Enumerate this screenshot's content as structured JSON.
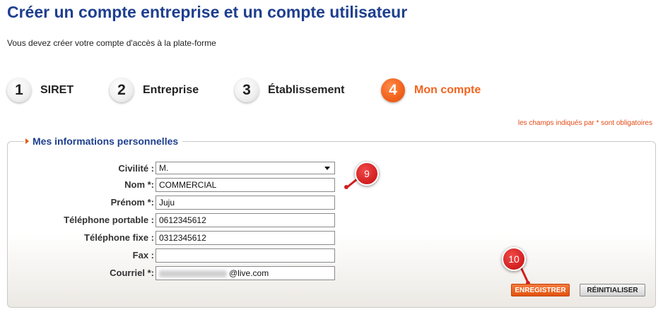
{
  "header": {
    "title": "Créer un compte entreprise et un compte utilisateur",
    "intro": "Vous devez créer votre compte d'accès à la plate-forme"
  },
  "steps": [
    {
      "number": "1",
      "label": "SIRET",
      "active": false
    },
    {
      "number": "2",
      "label": "Entreprise",
      "active": false
    },
    {
      "number": "3",
      "label": "Établissement",
      "active": false
    },
    {
      "number": "4",
      "label": "Mon compte",
      "active": true
    }
  ],
  "required_note": "les champs indiqués par * sont obligatoires",
  "form": {
    "legend": "Mes informations personnelles",
    "civilite": {
      "label": "Civilité :",
      "value": "M."
    },
    "nom": {
      "label": "Nom *:",
      "value": "COMMERCIAL"
    },
    "prenom": {
      "label": "Prénom *:",
      "value": "Juju"
    },
    "tel_portable": {
      "label": "Téléphone portable :",
      "value": "0612345612"
    },
    "tel_fixe": {
      "label": "Téléphone fixe :",
      "value": "0312345612"
    },
    "fax": {
      "label": "Fax :",
      "value": ""
    },
    "courriel": {
      "label": "Courriel *:",
      "value": "@live.com"
    }
  },
  "buttons": {
    "save": "ENREGISTRER",
    "reset": "RÉINITIALISER"
  },
  "callouts": {
    "c9": "9",
    "c10": "10"
  },
  "colors": {
    "title": "#1e3f8f",
    "accent": "#f2641e",
    "callout": "#d21e1e"
  }
}
